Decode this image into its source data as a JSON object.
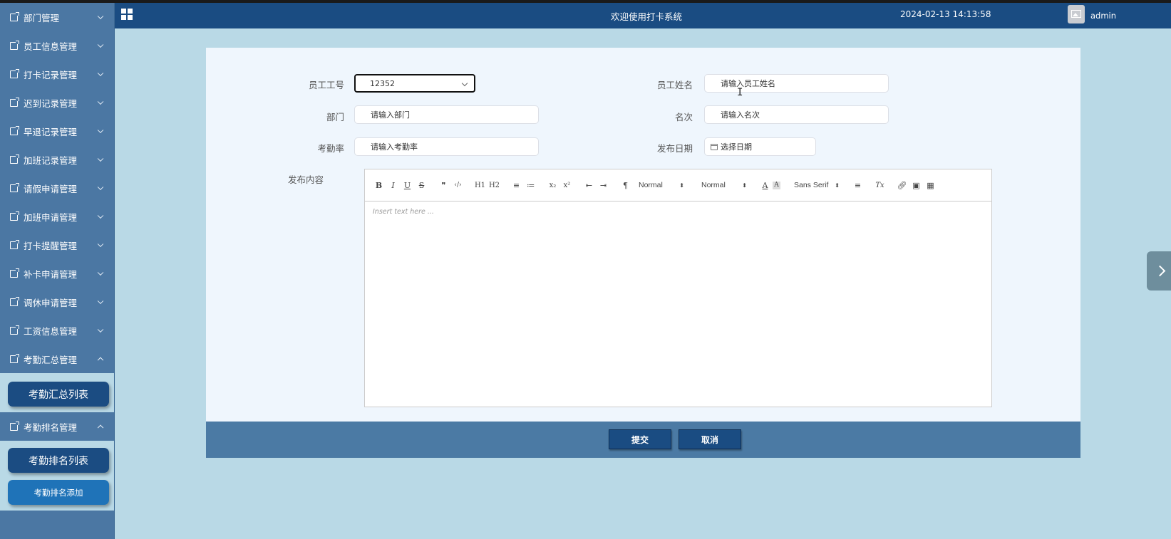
{
  "header": {
    "title": "欢迎使用打卡系统",
    "datetime": "2024-02-13 14:13:58",
    "username": "admin"
  },
  "sidebar": {
    "items": [
      {
        "label": "部门管理"
      },
      {
        "label": "员工信息管理"
      },
      {
        "label": "打卡记录管理"
      },
      {
        "label": "迟到记录管理"
      },
      {
        "label": "早退记录管理"
      },
      {
        "label": "加班记录管理"
      },
      {
        "label": "请假申请管理"
      },
      {
        "label": "加班申请管理"
      },
      {
        "label": "打卡提醒管理"
      },
      {
        "label": "补卡申请管理"
      },
      {
        "label": "调休申请管理"
      },
      {
        "label": "工资信息管理"
      },
      {
        "label": "考勤汇总管理",
        "expanded": true,
        "children": [
          {
            "label": "考勤汇总列表"
          }
        ]
      },
      {
        "label": "考勤排名管理",
        "expanded": true,
        "children": [
          {
            "label": "考勤排名列表"
          },
          {
            "label": "考勤排名添加"
          }
        ]
      }
    ]
  },
  "form": {
    "employee_id": {
      "label": "员工工号",
      "value": "12352"
    },
    "employee_name": {
      "label": "员工姓名",
      "placeholder": "请输入员工姓名"
    },
    "department": {
      "label": "部门",
      "placeholder": "请输入部门"
    },
    "rank": {
      "label": "名次",
      "placeholder": "请输入名次"
    },
    "attendance_rate": {
      "label": "考勤率",
      "placeholder": "请输入考勤率"
    },
    "publish_date": {
      "label": "发布日期",
      "placeholder": "选择日期"
    },
    "content": {
      "label": "发布内容",
      "placeholder": "Insert text here ..."
    }
  },
  "editor_toolbar": {
    "bold": "B",
    "italic": "I",
    "underline": "U",
    "strike": "S",
    "blockquote": "❞",
    "code": "‹/›",
    "h1": "H1",
    "h2": "H2",
    "ordered_list": "≡",
    "bullet_list": "≔",
    "subscript": "x₂",
    "superscript": "x²",
    "outdent": "⇤",
    "indent": "⇥",
    "direction": "¶",
    "size_select": "Normal",
    "header_select": "Normal",
    "font_select": "Sans Serif",
    "color": "A",
    "background": "A",
    "align": "≡",
    "clean": "Tx"
  },
  "actions": {
    "submit": "提交",
    "cancel": "取消"
  },
  "colors": {
    "header_bg": "#1a4c82",
    "sidebar_bg": "#4b77a3",
    "page_bg": "#b9d9e6",
    "panel_bg": "#eff6fd",
    "footer_bg": "#4b7aa4"
  }
}
